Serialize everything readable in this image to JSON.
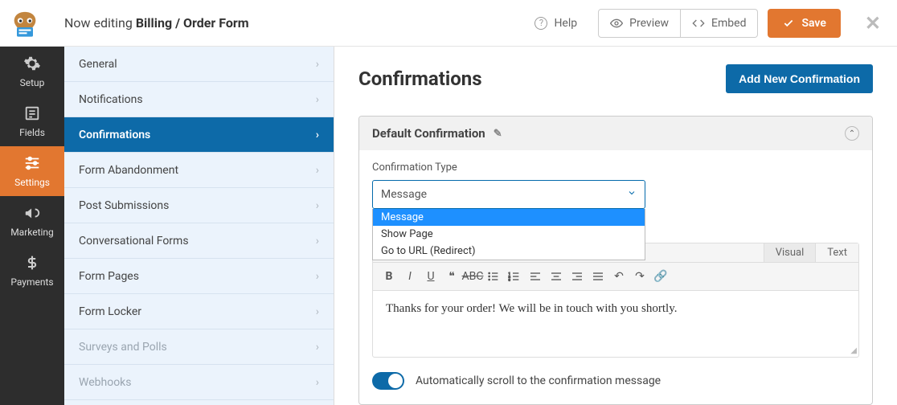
{
  "header": {
    "now_editing_prefix": "Now editing ",
    "form_name": "Billing / Order Form",
    "help": "Help",
    "preview": "Preview",
    "embed": "Embed",
    "save": "Save"
  },
  "rail": {
    "items": [
      {
        "label": "Setup"
      },
      {
        "label": "Fields"
      },
      {
        "label": "Settings"
      },
      {
        "label": "Marketing"
      },
      {
        "label": "Payments"
      }
    ]
  },
  "sidebar": {
    "items": [
      {
        "label": "General"
      },
      {
        "label": "Notifications"
      },
      {
        "label": "Confirmations"
      },
      {
        "label": "Form Abandonment"
      },
      {
        "label": "Post Submissions"
      },
      {
        "label": "Conversational Forms"
      },
      {
        "label": "Form Pages"
      },
      {
        "label": "Form Locker"
      },
      {
        "label": "Surveys and Polls"
      },
      {
        "label": "Webhooks"
      }
    ]
  },
  "main": {
    "title": "Confirmations",
    "add_button": "Add New Confirmation"
  },
  "panel": {
    "title": "Default Confirmation",
    "field_label": "Confirmation Type",
    "selected": "Message",
    "options": [
      "Message",
      "Show Page",
      "Go to URL (Redirect)"
    ],
    "editor_tabs": {
      "visual": "Visual",
      "text": "Text"
    },
    "content": "Thanks for your order! We will be in touch with you shortly.",
    "toggle_label": "Automatically scroll to the confirmation message"
  }
}
